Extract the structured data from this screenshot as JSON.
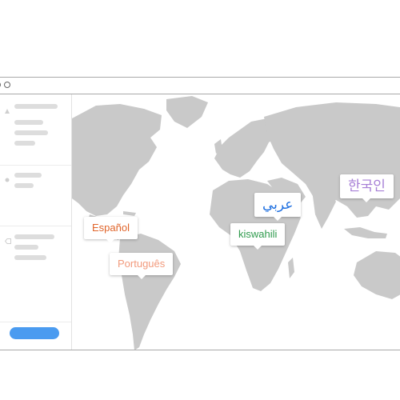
{
  "window": {
    "controls": [
      "circle",
      "circle"
    ]
  },
  "sidebar": {
    "sections": [
      "triangle-icon",
      "dot-icon",
      "tag-icon"
    ],
    "primary_button": ""
  },
  "map": {
    "labels": {
      "spanish": "Español",
      "portuguese": "Português",
      "swahili": "kiswahili",
      "arabic": "عربي",
      "korean": "한국인"
    },
    "colors": {
      "spanish": "#e0642a",
      "portuguese": "#f29a7c",
      "swahili": "#2e9a4c",
      "arabic": "#1d6fe0",
      "korean": "#a77fd6"
    }
  }
}
